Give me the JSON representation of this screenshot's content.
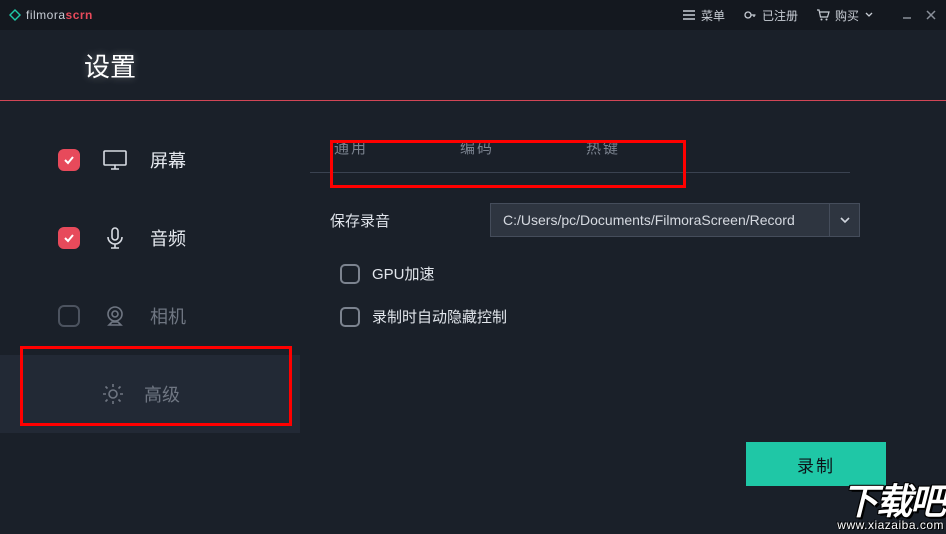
{
  "brand": {
    "name_a": "filmora",
    "name_b": "scrn"
  },
  "topmenu": {
    "menu": "菜单",
    "registered": "已注册",
    "buy": "购买"
  },
  "page_title": "设置",
  "sidebar": {
    "items": [
      {
        "label": "屏幕",
        "checked": true
      },
      {
        "label": "音频",
        "checked": true
      },
      {
        "label": "相机",
        "checked": false
      },
      {
        "label": "高级",
        "checked": null
      }
    ]
  },
  "tabs": {
    "general": "通用",
    "encode": "编码",
    "hotkey": "热键"
  },
  "form": {
    "save_label": "保存录音",
    "save_path": "C:/Users/pc/Documents/FilmoraScreen/Record",
    "gpu_label": "GPU加速",
    "autohide_label": "录制时自动隐藏控制"
  },
  "record_label": "录制",
  "watermark": {
    "big": "下载吧",
    "url": "www.xiazaiba.com"
  }
}
